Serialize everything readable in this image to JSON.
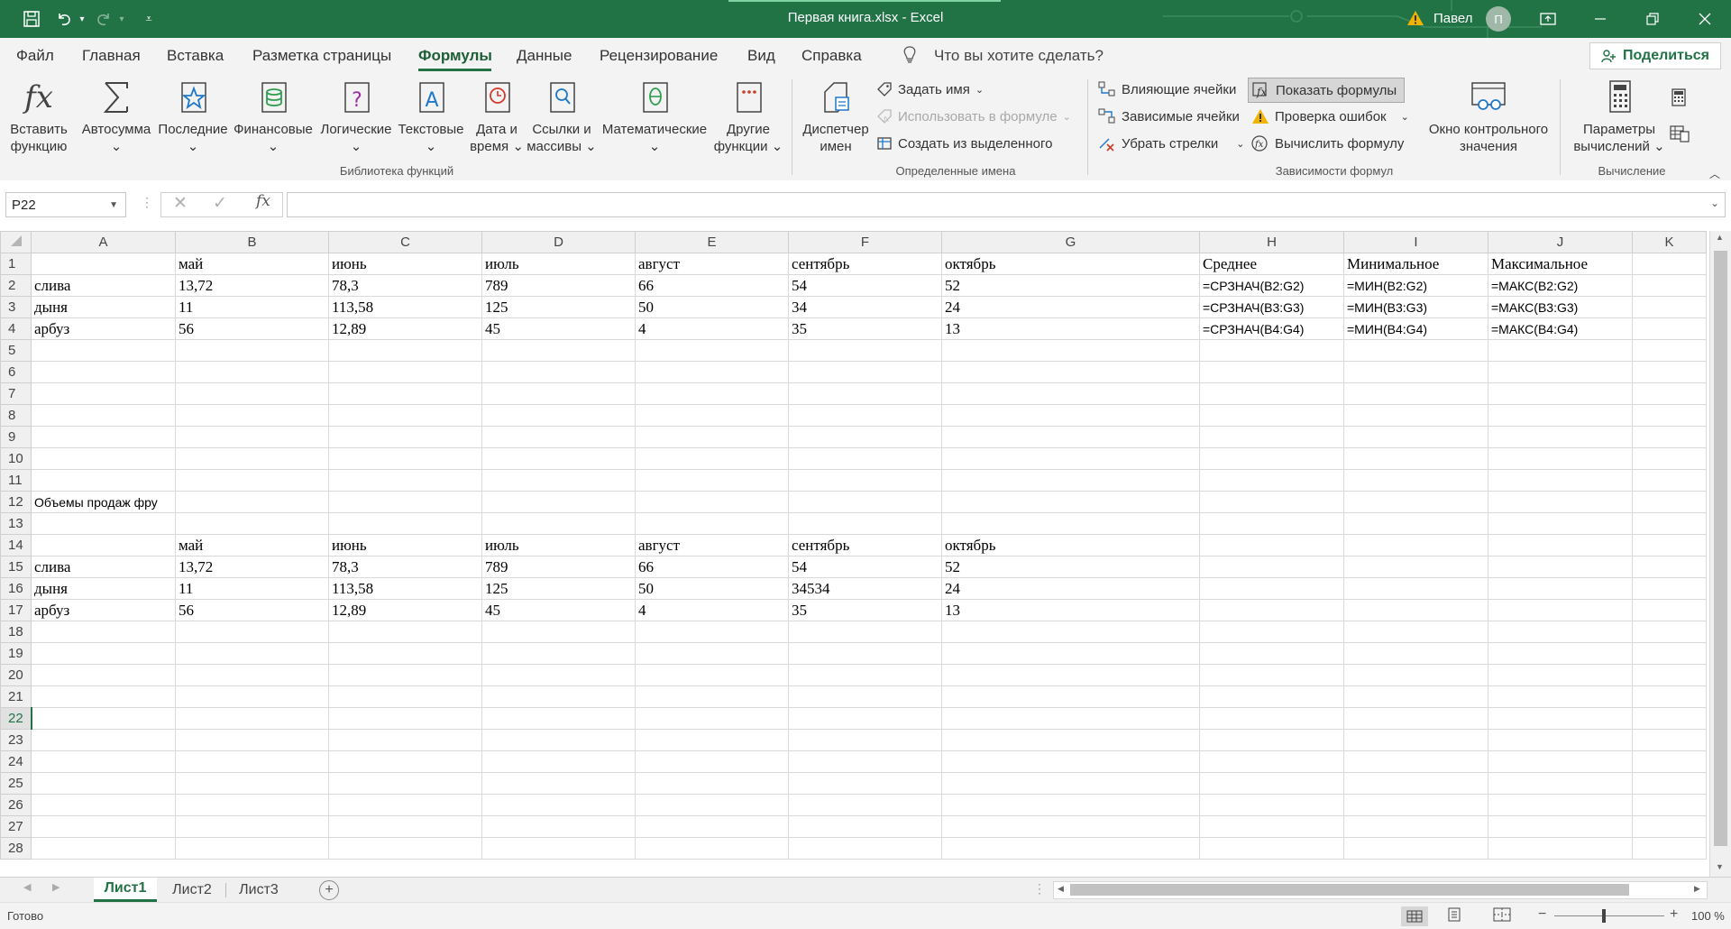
{
  "window": {
    "title": "Первая книга.xlsx  -  Excel",
    "user_name": "Павел",
    "user_initial": "П"
  },
  "menu": {
    "items": [
      "Файл",
      "Главная",
      "Вставка",
      "Разметка страницы",
      "Формулы",
      "Данные",
      "Рецензирование",
      "Вид",
      "Справка"
    ],
    "active": "Формулы",
    "search_placeholder": "Что вы хотите сделать?",
    "share_label": "Поделиться"
  },
  "ribbon": {
    "insert_function": [
      "Вставить",
      "функцию"
    ],
    "library": [
      {
        "l1": "Автосумма",
        "l2": "",
        "icon": "sigma-icon"
      },
      {
        "l1": "Последние",
        "l2": "",
        "icon": "star-icon"
      },
      {
        "l1": "Финансовые",
        "l2": "",
        "icon": "coins-icon"
      },
      {
        "l1": "Логические",
        "l2": "",
        "icon": "question-icon"
      },
      {
        "l1": "Текстовые",
        "l2": "",
        "icon": "text-icon"
      },
      {
        "l1": "Дата и",
        "l2": "время",
        "icon": "clock-icon"
      },
      {
        "l1": "Ссылки и",
        "l2": "массивы",
        "icon": "lookup-icon"
      },
      {
        "l1": "Математические",
        "l2": "",
        "icon": "theta-icon"
      },
      {
        "l1": "Другие",
        "l2": "функции",
        "icon": "more-icon"
      }
    ],
    "library_group_label": "Библиотека функций",
    "name_manager": [
      "Диспетчер",
      "имен"
    ],
    "define_name": "Задать имя",
    "use_in_formula": "Использовать в формуле",
    "create_from_selection": "Создать из выделенного",
    "names_group_label": "Определенные имена",
    "trace_precedents": "Влияющие ячейки",
    "trace_dependents": "Зависимые ячейки",
    "remove_arrows": "Убрать стрелки",
    "show_formulas": "Показать формулы",
    "error_checking": "Проверка ошибок",
    "evaluate_formula": "Вычислить формулу",
    "watch_window": [
      "Окно контрольного",
      "значения"
    ],
    "auditing_group_label": "Зависимости формул",
    "calc_options": [
      "Параметры",
      "вычислений"
    ],
    "calc_group_label": "Вычисление"
  },
  "formula_bar": {
    "name_box": "P22",
    "formula": "",
    "fx": "fx"
  },
  "sheet": {
    "columns": [
      "A",
      "B",
      "C",
      "D",
      "E",
      "F",
      "G",
      "H",
      "I",
      "J",
      "K"
    ],
    "rows": [
      [
        "",
        "май",
        "июнь",
        "июль",
        "август",
        "сентябрь",
        "октябрь",
        "Среднее",
        "Минимальное",
        "Максимальное"
      ],
      [
        "слива",
        "13,72",
        "78,3",
        "789",
        "66",
        "54",
        "52",
        "=СРЗНАЧ(B2:G2)",
        "=МИН(B2:G2)",
        "=МАКС(B2:G2)"
      ],
      [
        "дыня",
        "11",
        "113,58",
        "125",
        "50",
        "34",
        "24",
        "=СРЗНАЧ(B3:G3)",
        "=МИН(B3:G3)",
        "=МАКС(B3:G3)"
      ],
      [
        "арбуз",
        "56",
        "12,89",
        "45",
        "4",
        "35",
        "13",
        "=СРЗНАЧ(B4:G4)",
        "=МИН(B4:G4)",
        "=МАКС(B4:G4)"
      ],
      [],
      [],
      [],
      [],
      [],
      [],
      [],
      [
        "Объемы продаж фру"
      ],
      [],
      [
        "",
        "май",
        "июнь",
        "июль",
        "август",
        "сентябрь",
        "октябрь"
      ],
      [
        "слива",
        "13,72",
        "78,3",
        "789",
        "66",
        "54",
        "52"
      ],
      [
        "дыня",
        "11",
        "113,58",
        "125",
        "50",
        "34534",
        "24"
      ],
      [
        "арбуз",
        "56",
        "12,89",
        "45",
        "4",
        "35",
        "13"
      ],
      [],
      [],
      [],
      [],
      [],
      [],
      [],
      [],
      [],
      [],
      []
    ],
    "selected_row": 22
  },
  "sheet_tabs": {
    "tabs": [
      "Лист1",
      "Лист2",
      "Лист3"
    ],
    "active": "Лист1"
  },
  "status": {
    "ready": "Готово",
    "zoom": "100 %"
  },
  "colors": {
    "excel_green": "#217346",
    "ribbon_bg": "#f3f3f3"
  }
}
